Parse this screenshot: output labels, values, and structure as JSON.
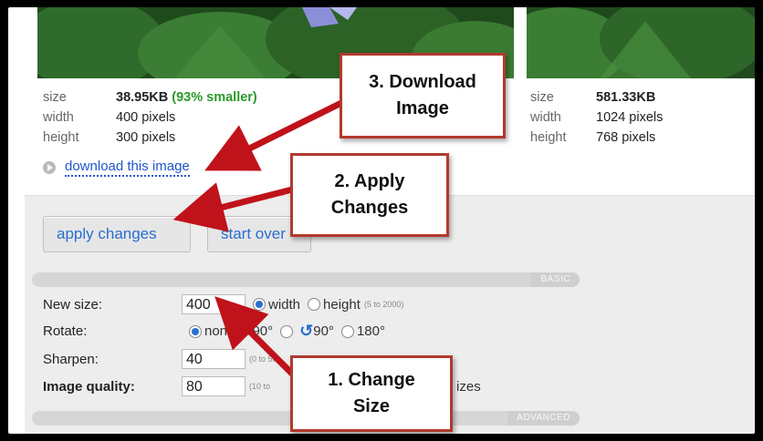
{
  "left_image": {
    "size_label": "size",
    "size_value": "38.95KB",
    "size_note": "(93% smaller)",
    "width_label": "width",
    "width_value": "400 pixels",
    "height_label": "height",
    "height_value": "300 pixels",
    "download_link": "download this image"
  },
  "right_image": {
    "size_label": "size",
    "size_value": "581.33KB",
    "width_label": "width",
    "width_value": "1024 pixels",
    "height_label": "height",
    "height_value": "768 pixels"
  },
  "buttons": {
    "apply": "apply changes",
    "start_over": "start over"
  },
  "sections": {
    "basic": "BASIC",
    "advanced": "ADVANCED"
  },
  "form": {
    "new_size_label": "New size:",
    "new_size_value": "400",
    "width_option": "width",
    "height_option": "height",
    "size_hint": "(5 to 2000)",
    "rotate_label": "Rotate:",
    "rotate_none": "none",
    "rotate_90a": "90°",
    "rotate_90b": "90°",
    "rotate_180": "180°",
    "sharpen_label": "Sharpen:",
    "sharpen_value": "40",
    "sharpen_hint": "(0 to 50)",
    "quality_label": "Image quality:",
    "quality_value": "80",
    "quality_hint": "(10 to",
    "quality_trail": "izes"
  },
  "callouts": {
    "step3_line1": "3. Download",
    "step3_line2": "Image",
    "step2_line1": "2. Apply",
    "step2_line2": "Changes",
    "step1_line1": "1. Change",
    "step1_line2": "Size"
  },
  "colors": {
    "accent": "#2a6ecf",
    "callout_border": "#b13a2e",
    "arrow": "#c0121a",
    "savings": "#2a9a2a"
  }
}
